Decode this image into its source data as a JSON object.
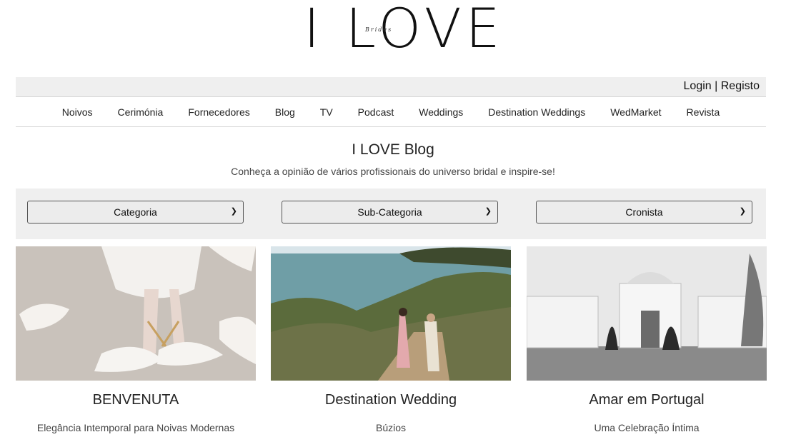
{
  "brand": {
    "logo": "I LOVE",
    "logo_sub": "Brides"
  },
  "auth": {
    "login": "Login",
    "separator": "|",
    "register": "Registo"
  },
  "nav": [
    "Noivos",
    "Cerimónia",
    "Fornecedores",
    "Blog",
    "TV",
    "Podcast",
    "Weddings",
    "Destination Weddings",
    "WedMarket",
    "Revista"
  ],
  "page": {
    "title": "I LOVE Blog",
    "subtitle": "Conheça a opinião de vários profissionais do universo bridal e inspire-se!"
  },
  "filters": [
    "Categoria",
    "Sub-Categoria",
    "Cronista"
  ],
  "cards": [
    {
      "title": "BENVENUTA",
      "subtitle": "Elegância Intemporal para Noivas Modernas",
      "image": "white-bridal-shoes-photo"
    },
    {
      "title": "Destination Wedding",
      "subtitle": "Búzios",
      "image": "couple-coastal-path-photo"
    },
    {
      "title": "Amar em Portugal",
      "subtitle": "Uma Celebração Íntima",
      "image": "palace-black-white-photo"
    }
  ]
}
